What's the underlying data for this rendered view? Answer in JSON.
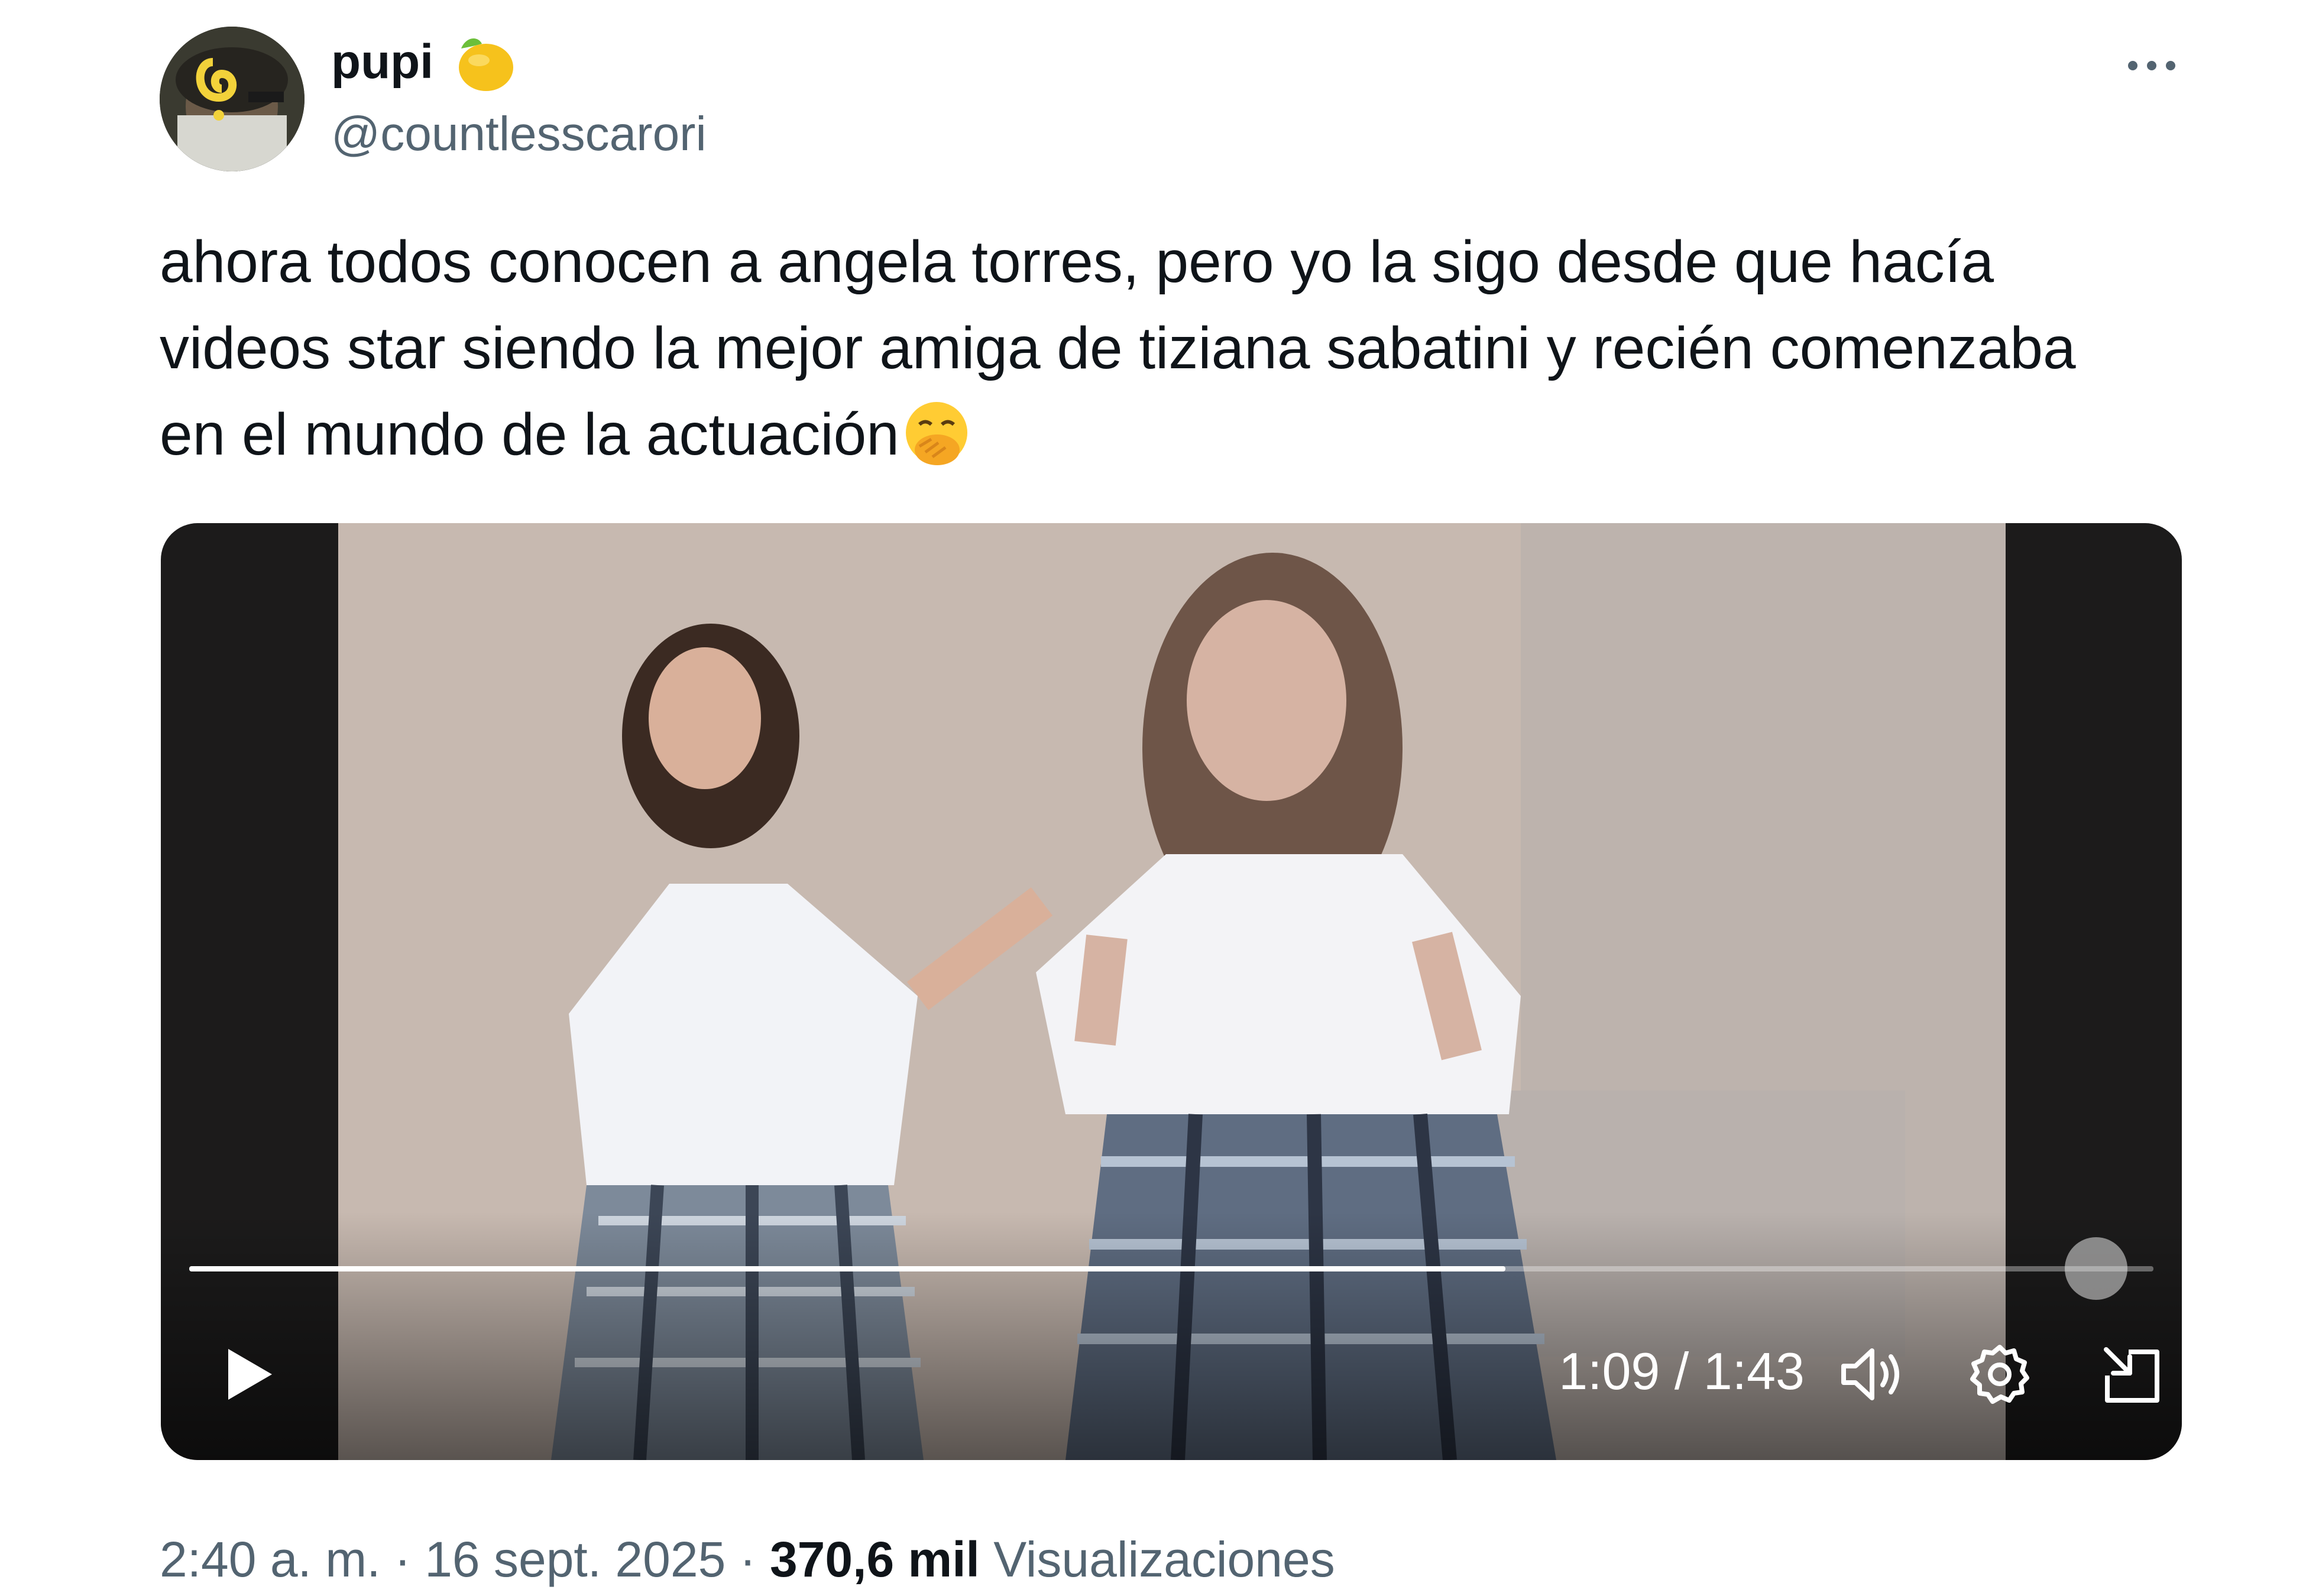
{
  "author": {
    "display_name": "pupi",
    "name_emoji": "lemon",
    "handle": "@countlesscarori"
  },
  "icons": {
    "more": "more-horizontal-icon",
    "play": "play-icon",
    "volume": "volume-icon",
    "settings": "gear-icon",
    "pip": "picture-in-picture-icon",
    "fullscreen": "fullscreen-expand-icon"
  },
  "tweet": {
    "lines": [
      "ahora todos conocen a angela torres, pero yo la sigo desde que hacía",
      "videos star siendo la mejor amiga de tiziana sabatini y recién comenzaba",
      "en el mundo de la actuación"
    ],
    "trailing_emoji": "face-with-hand-over-mouth"
  },
  "video": {
    "current_time": "1:09",
    "duration": "1:43",
    "time_display": "1:09 / 1:43",
    "progress_fraction": 0.67
  },
  "footer": {
    "time": "2:40 a. m.",
    "separator": "·",
    "date": "16 sept. 2025",
    "views_count": "370,6 mil",
    "views_label": "Visualizaciones"
  },
  "colors": {
    "text_primary": "#0f1419",
    "text_secondary": "#536471",
    "video_letterbox": "#1c1b1b"
  }
}
